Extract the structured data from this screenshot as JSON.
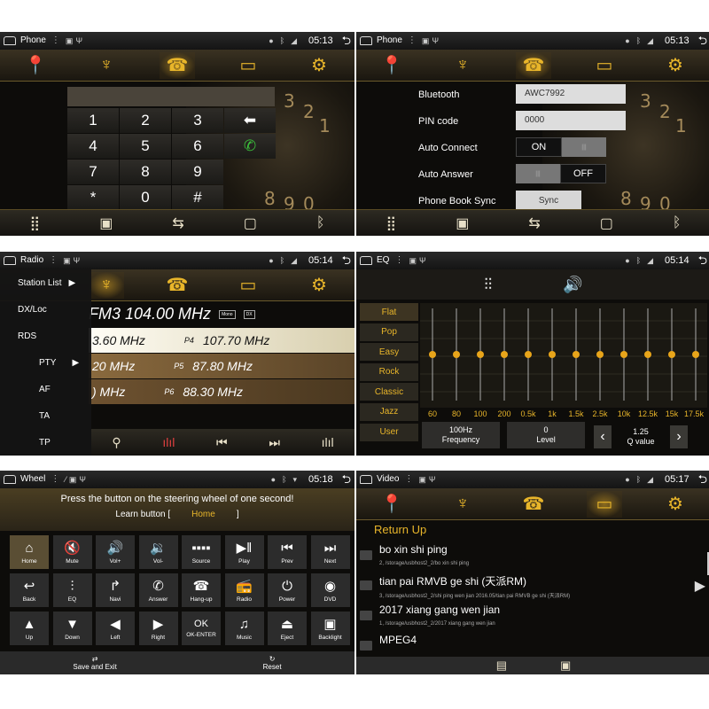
{
  "status": {
    "phone_time": "05:13",
    "radio_time": "05:14",
    "eq_time": "05:14",
    "wheel_time": "05:18",
    "video_time": "05:17"
  },
  "phone": {
    "title": "Phone",
    "keys": [
      "1",
      "2",
      "3",
      "4",
      "5",
      "6",
      "7",
      "8",
      "9",
      "*",
      "0",
      "#"
    ],
    "dial_bg": [
      "3",
      "2",
      "1",
      "8",
      "9",
      "0"
    ],
    "settings": {
      "bluetooth_label": "Bluetooth",
      "bluetooth_value": "AWC7992",
      "pin_label": "PIN code",
      "pin_value": "0000",
      "auto_connect_label": "Auto Connect",
      "auto_connect_on": "ON",
      "auto_connect_off": "|||",
      "auto_answer_label": "Auto Answer",
      "auto_answer_on": "|||",
      "auto_answer_off": "OFF",
      "sync_label": "Phone Book Sync",
      "sync_button": "Sync"
    }
  },
  "radio": {
    "title": "Radio",
    "menu": [
      "Station List",
      "DX/Loc",
      "RDS",
      "PTY",
      "AF",
      "TA",
      "TP"
    ],
    "band_freq": "FM3 104.00 MHz",
    "mono": "Mono",
    "dx": "DX",
    "rows": [
      {
        "left": "3.60  MHz",
        "preset": "P4",
        "right": "107.70  MHz"
      },
      {
        "left": "20  MHz",
        "preset": "P5",
        "right": "87.80  MHz"
      },
      {
        "left": ")  MHz",
        "preset": "P6",
        "right": "88.30  MHz"
      }
    ]
  },
  "eq": {
    "title": "EQ",
    "presets": [
      "Flat",
      "Pop",
      "Easy",
      "Rock",
      "Classic",
      "Jazz",
      "User"
    ],
    "freqs": [
      "60",
      "80",
      "100",
      "200",
      "0.5k",
      "1k",
      "1.5k",
      "2.5k",
      "10k",
      "12.5k",
      "15k",
      "17.5k"
    ],
    "frequency_value": "100Hz",
    "frequency_label": "Frequency",
    "level_value": "0",
    "level_label": "Level",
    "q_value": "1.25",
    "q_label": "Q value"
  },
  "wheel": {
    "title": "Wheel",
    "instruction": "Press the button on the steering wheel of one second!",
    "learn_label": "Learn button [",
    "learn_value": "Home",
    "learn_end": "]",
    "buttons": [
      {
        "icon": "⌂",
        "label": "Home"
      },
      {
        "icon": "🔇",
        "label": "Mute"
      },
      {
        "icon": "🔊",
        "label": "Vol+"
      },
      {
        "icon": "🔉",
        "label": "Vol-"
      },
      {
        "icon": "▪▪▪▪",
        "label": "Source"
      },
      {
        "icon": "▶‖",
        "label": "Play"
      },
      {
        "icon": "⏮",
        "label": "Prev"
      },
      {
        "icon": "⏭",
        "label": "Next"
      },
      {
        "icon": "↩",
        "label": "Back"
      },
      {
        "icon": "⫶",
        "label": "EQ"
      },
      {
        "icon": "↱",
        "label": "Navi"
      },
      {
        "icon": "✆",
        "label": "Answer"
      },
      {
        "icon": "☎",
        "label": "Hang-up"
      },
      {
        "icon": "📻",
        "label": "Radio"
      },
      {
        "icon": "⏻",
        "label": "Power"
      },
      {
        "icon": "◉",
        "label": "DVD"
      },
      {
        "icon": "▲",
        "label": "Up"
      },
      {
        "icon": "▼",
        "label": "Down"
      },
      {
        "icon": "◀",
        "label": "Left"
      },
      {
        "icon": "▶",
        "label": "Right"
      },
      {
        "icon": "OK",
        "label": "OK-ENTER"
      },
      {
        "icon": "♫",
        "label": "Music"
      },
      {
        "icon": "⏏",
        "label": "Eject"
      },
      {
        "icon": "▣",
        "label": "Backlight"
      }
    ],
    "save_exit": "Save and Exit",
    "reset": "Reset"
  },
  "video": {
    "title": "Video",
    "return_up": "Return Up",
    "items": [
      {
        "name": "bo  xin shi ping",
        "path": "2, /storage/usbhost2_2/bo  xin shi ping"
      },
      {
        "name": "tian pai RMVB  ge shi (天派RM)",
        "path": "3, /storage/usbhost2_2/shi  ping  wen  jian 2016.05/tian pai RMVB  ge shi (天派RM)"
      },
      {
        "name": "2017 xiang gang wen  jian",
        "path": "1, /storage/usbhost2_2/2017 xiang gang wen  jian"
      },
      {
        "name": "MPEG4",
        "path": ""
      }
    ]
  },
  "colors": {
    "accent": "#e8b52a",
    "bar": "#1a160f"
  }
}
